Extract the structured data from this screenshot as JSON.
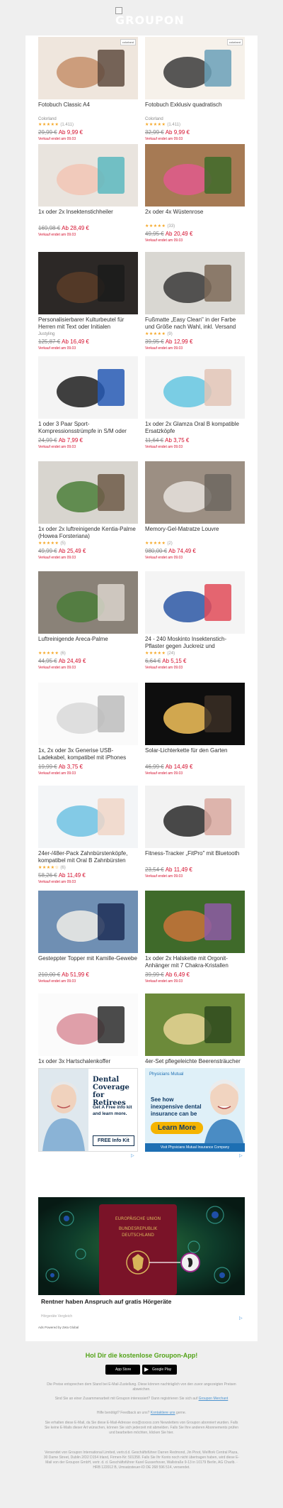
{
  "header": {
    "logo_text": "GROUPON",
    "logo_icon": "broken-image-icon"
  },
  "deals": [
    {
      "title": "Fotobuch Classic A4",
      "merchant": "Colorland",
      "stars": "★★★★★",
      "reviews": "(1.411)",
      "old_price": "29,99 €",
      "new_price": "Ab 9,99 €",
      "ends": "Verkauf endet am 09.03",
      "badge": "colorland"
    },
    {
      "title": "Fotobuch Exklusiv quadratisch",
      "merchant": "Colorland",
      "stars": "★★★★★",
      "reviews": "(1.411)",
      "old_price": "32,99 €",
      "new_price": "Ab 9,99 €",
      "ends": "Verkauf endet am 09.03",
      "badge": "colorland"
    },
    {
      "title": "1x oder 2x Insektenstichheiler",
      "merchant": "",
      "stars": "",
      "reviews": "",
      "old_price": "169,98 €",
      "new_price": "Ab 28,49 €",
      "ends": "Verkauf endet am 09.03"
    },
    {
      "title": "2x oder 4x Wüstenrose",
      "merchant": "",
      "stars": "★★★★★",
      "reviews": "(33)",
      "old_price": "49,95 €",
      "new_price": "Ab 20,49 €",
      "ends": "Verkauf endet am 09.03"
    },
    {
      "title": "Personalisierbarer Kulturbeutel für Herren mit Text oder Initialen",
      "merchant": "Justyling",
      "stars": "",
      "reviews": "",
      "old_price": "125,87 €",
      "new_price": "Ab 16,49 €",
      "ends": "Verkauf endet am 09.03"
    },
    {
      "title": "Fußmatte „Easy Clean\" in der Farbe und Größe nach Wahl, inkl. Versand",
      "merchant": "",
      "stars": "★★★★★",
      "reviews": "(9)",
      "old_price": "39,95 €",
      "new_price": "Ab 12,99 €",
      "ends": "Verkauf endet am 09.03"
    },
    {
      "title": "1 oder 3 Paar Sport-Kompressionsstrümpfe in S/M oder L/XL",
      "merchant": "",
      "stars": "",
      "reviews": "",
      "old_price": "24,99 €",
      "new_price": "Ab 7,99 €",
      "ends": "Verkauf endet am 09.03"
    },
    {
      "title": "1x oder 2x Glamza Oral B kompatible Ersatzköpfe",
      "merchant": "",
      "stars": "",
      "reviews": "",
      "old_price": "11,64 €",
      "new_price": "Ab 3,75 €",
      "ends": "Verkauf endet am 09.03"
    },
    {
      "title": "1x oder 2x luftreinigende Kentia-Palme (Howea Forsteriana)",
      "merchant": "",
      "stars": "★★★★★",
      "reviews": "(5)",
      "old_price": "49,99 €",
      "new_price": "Ab 25,49 €",
      "ends": "Verkauf endet am 09.03"
    },
    {
      "title": "Memory-Gel-Matratze Louvre",
      "merchant": "",
      "stars": "★★★★★",
      "reviews": "(2)",
      "old_price": "980,00 €",
      "new_price": "Ab 74,49 €",
      "ends": "Verkauf endet am 09.03"
    },
    {
      "title": "Luftreinigende Areca-Palme",
      "merchant": "",
      "stars": "★★★★★",
      "reviews": "(6)",
      "old_price": "44,95 €",
      "new_price": "Ab 24,49 €",
      "ends": "Verkauf endet am 09.03"
    },
    {
      "title": "24 - 240 Moskinto Insektenstich-Pflaster gegen Juckreiz und Schwellung",
      "merchant": "",
      "stars": "★★★★★",
      "reviews": "(24)",
      "old_price": "6,64 €",
      "new_price": "Ab 5,15 €",
      "ends": "Verkauf endet am 09.03"
    },
    {
      "title": "1x, 2x oder 3x Generise USB-Ladekabel, kompatibel mit iPhones",
      "merchant": "",
      "stars": "",
      "reviews": "",
      "old_price": "19,99 €",
      "new_price": "Ab 3,75 €",
      "ends": "Verkauf endet am 09.03"
    },
    {
      "title": "Solar-Lichterkette für den Garten",
      "merchant": "",
      "stars": "",
      "reviews": "",
      "old_price": "46,99 €",
      "new_price": "Ab 14,49 €",
      "ends": "Verkauf endet am 09.03"
    },
    {
      "title": "24er-/48er-Pack Zahnbürstenköpfe, kompatibel mit Oral B Zahnbürsten",
      "merchant": "",
      "stars": "★★★★☆",
      "reviews": "(6)",
      "old_price": "58,26 €",
      "new_price": "Ab 11,49 €",
      "ends": "Verkauf endet am 09.03"
    },
    {
      "title": "Fitness-Tracker „FitPro\" mit Bluetooth",
      "merchant": "",
      "stars": "",
      "reviews": "",
      "old_price": "23,54 €",
      "new_price": "Ab 11,49 €",
      "ends": "Verkauf endet am 09.03"
    },
    {
      "title": "Gesteppter Topper mit Kamille-Gewebe",
      "merchant": "",
      "stars": "",
      "reviews": "",
      "old_price": "210,00 €",
      "new_price": "Ab 51,99 €",
      "ends": "Verkauf endet am 09.03"
    },
    {
      "title": "1x oder 2x Halskette mit Orgonit-Anhänger mit 7 Chakra-Kristallen",
      "merchant": "",
      "stars": "",
      "reviews": "",
      "old_price": "39,99 €",
      "new_price": "Ab 6,49 €",
      "ends": "Verkauf endet am 09.03"
    },
    {
      "title": "1x oder 3x Hartschalenkoffer",
      "merchant": "",
      "stars": "★★★★★",
      "reviews": "(16)",
      "old_price": "99,63 €",
      "new_price": "Ab 33,99 €",
      "ends": "Verkauf endet am 09.03"
    },
    {
      "title": "4er-Set pflegeleichte Beerensträucher",
      "merchant": "",
      "stars": "★★★★★",
      "reviews": "(1)",
      "old_price": "49,95 €",
      "new_price": "Ab 23,99 €",
      "ends": "Verkauf endet am 09.03"
    }
  ],
  "ads": {
    "ad1": {
      "headline": "Dental Coverage for Retirees",
      "sub": "Get A Free info kit and learn more.",
      "button": "FREE Info Kit"
    },
    "ad2": {
      "brand": "Physicians Mutual",
      "headline": "See how inexpensive dental insurance can be",
      "button": "Learn More",
      "footer": "Visit Physicians Mutual Insurance Company"
    },
    "adchoices_icon": "adchoices-icon",
    "big": {
      "title": "Rentner haben Anspruch auf gratis Hörgeräte",
      "meta": "Hörgeräte Vergleich",
      "powered": "Ads Powered by Zeta Global"
    }
  },
  "app": {
    "headline": "Hol Dir die kostenlose Groupon-App!",
    "appstore": "App Store",
    "googleplay": "Google Play"
  },
  "legal": {
    "p1": "Die Preise entsprechen dem Stand bei E-Mail-Zustellung. Diese können nachträglich von den zuvor angezeigten Preisen abweichen.",
    "p2_text": "Sind Sie an einer Zusammenarbeit mit Groupon interessiert? Dann registrieren Sie sich auf",
    "p2_link": "Groupon Merchant",
    "p3_text": "Hilfe benötigt? Feedback an uns?",
    "p3_link": "Kontaktiere uns",
    "p3_end": "gerne.",
    "p4": "Sie erhalten diese E-Mail, da Sie diese E-Mail-Adresse exx@xxxxxx.com Newsletters von Groupon abonniert wurden. Falls Sie keine E-Mails dieser Art wünschen, können Sie sich jederzeit mit abmelden. Falls Sie Ihre anderen Abonnements prüfen und bearbeiten möchten, klicken Sie hier.",
    "p5": "Versendet von Groupon International Limited, vertr.d.d. Geschäftsführer Darren Redmond, Jin Pinot, Wellfork Central Plaza, 30 Dame Street, Dublin 2/D2 D154 Irland, Firmen-Nr: 501358. Falls Sie Ihr Konto noch nicht übertragen haben, wird diese E-Mail von der Groupon GmbH, vertr. d. d. Geschäftsführer Karel Gusserhover, Wallstraße 9-13 in 10179 Berlin, AG Charlb. · HRB 122012 B, Umsatzsteuer-ID DE 268 596 514, versendet."
  }
}
